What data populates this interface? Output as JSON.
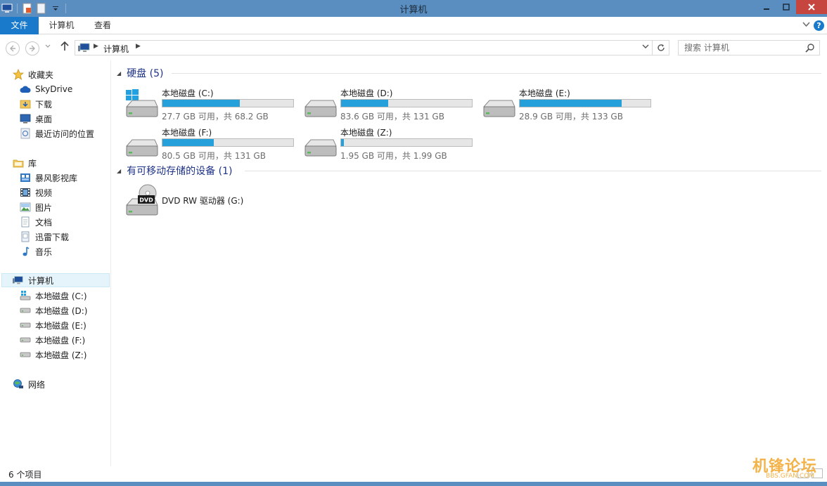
{
  "window": {
    "title": "计算机"
  },
  "ribbon": {
    "tabs": [
      "文件",
      "计算机",
      "查看"
    ]
  },
  "address": {
    "crumb": "计算机"
  },
  "search": {
    "placeholder": "搜索 计算机"
  },
  "sidebar": {
    "favorites": {
      "header": "收藏夹",
      "items": [
        "SkyDrive",
        "下载",
        "桌面",
        "最近访问的位置"
      ]
    },
    "libraries": {
      "header": "库",
      "items": [
        "暴风影视库",
        "视频",
        "图片",
        "文档",
        "迅雷下载",
        "音乐"
      ]
    },
    "computer": {
      "header": "计算机",
      "items": [
        "本地磁盘 (C:)",
        "本地磁盘 (D:)",
        "本地磁盘 (E:)",
        "本地磁盘 (F:)",
        "本地磁盘 (Z:)"
      ]
    },
    "network": {
      "header": "网络"
    }
  },
  "groups": {
    "hard_disks": {
      "title": "硬盘 (5)"
    },
    "removable": {
      "title": "有可移动存储的设备 (1)"
    }
  },
  "drives": [
    {
      "name": "本地磁盘 (C:)",
      "size": "27.7 GB 可用，共 68.2 GB",
      "used_fraction": 0.59,
      "system": true
    },
    {
      "name": "本地磁盘 (D:)",
      "size": "83.6 GB 可用，共 131 GB",
      "used_fraction": 0.36,
      "system": false
    },
    {
      "name": "本地磁盘 (E:)",
      "size": "28.9 GB 可用，共 133 GB",
      "used_fraction": 0.78,
      "system": false
    },
    {
      "name": "本地磁盘 (F:)",
      "size": "80.5 GB 可用，共 131 GB",
      "used_fraction": 0.39,
      "system": false
    },
    {
      "name": "本地磁盘 (Z:)",
      "size": "1.95 GB 可用，共 1.99 GB",
      "used_fraction": 0.02,
      "system": false
    }
  ],
  "dvd": {
    "name": "DVD RW 驱动器 (G:)",
    "badge": "DVD"
  },
  "status": {
    "count": "6 个项目"
  },
  "watermark": {
    "main": "机锋论坛",
    "sub": "BBS.GFAN.COM"
  },
  "colors": {
    "accent": "#1979ca",
    "bar_fill": "#26a0da",
    "titlebar": "#5b8ec0",
    "group_title": "#1e3287"
  }
}
